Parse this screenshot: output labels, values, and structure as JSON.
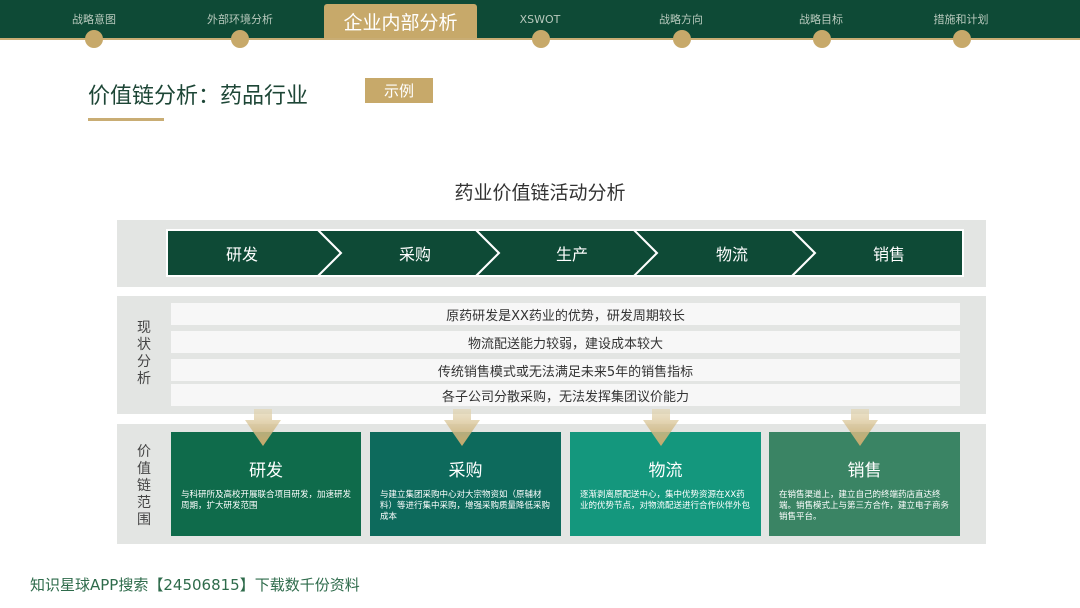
{
  "nav": {
    "items": [
      {
        "label": "战略意图"
      },
      {
        "label": "外部环境分析"
      },
      {
        "label": "企业内部分析",
        "active": true
      },
      {
        "label": "XSWOT"
      },
      {
        "label": "战略方向"
      },
      {
        "label": "战略目标"
      },
      {
        "label": "措施和计划"
      }
    ]
  },
  "header": {
    "title": "价值链分析：药品行业",
    "tag": "示例"
  },
  "diagram": {
    "title": "药业价值链活动分析",
    "stages": [
      "研发",
      "采购",
      "生产",
      "物流",
      "销售"
    ],
    "analysis_label": "现状分析",
    "analysis_rows": [
      "原药研发是XX药业的优势，研发周期较长",
      "物流配送能力较弱，建设成本较大",
      "传统销售模式或无法满足未来5年的销售指标",
      "各子公司分散采购，无法发挥集团议价能力"
    ],
    "scope_label": "价值链范围",
    "scope_cards": [
      {
        "title": "研发",
        "desc": "与科研所及高校开展联合项目研发，加速研发周期，扩大研发范围"
      },
      {
        "title": "采购",
        "desc": "与建立集团采购中心对大宗物资如（原辅材料）等进行集中采购，增强采购质量降低采购成本"
      },
      {
        "title": "物流",
        "desc": "逐渐剥离原配送中心，集中优势资源在XX药业的优势节点，对物流配送进行合作伙伴外包"
      },
      {
        "title": "销售",
        "desc": "在销售渠道上，建立自己的终端药店直达终端。销售模式上与第三方合作，建立电子商务销售平台。"
      }
    ]
  },
  "colors": {
    "dark_green": "#0e4a36",
    "gold": "#c7a96a",
    "card_1": "#0f6b4b",
    "card_2": "#0d6a5c",
    "card_3": "#14977d",
    "card_4": "#3a8464"
  },
  "footer": {
    "text": "知识星球APP搜索【24506815】下载数千份资料"
  }
}
